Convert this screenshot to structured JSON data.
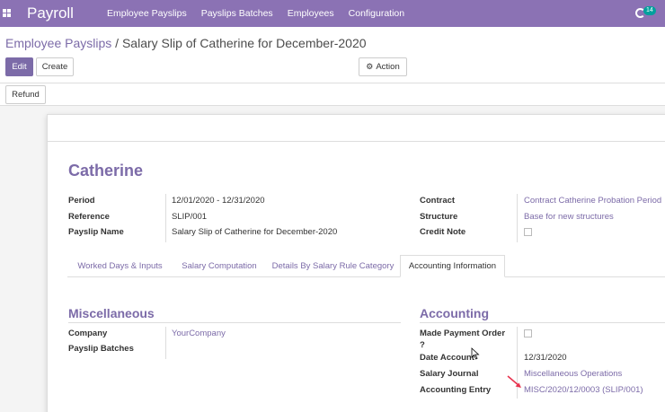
{
  "topbar": {
    "app_name": "Payroll",
    "menu": [
      "Employee Payslips",
      "Payslips Batches",
      "Employees",
      "Configuration"
    ],
    "activity_count": "14"
  },
  "breadcrumb": {
    "parent": "Employee Payslips",
    "separator": "/",
    "current": "Salary Slip of Catherine for December-2020"
  },
  "buttons": {
    "edit": "Edit",
    "create": "Create",
    "action": "Action",
    "refund": "Refund"
  },
  "record": {
    "employee_name": "Catherine",
    "left_fields": [
      {
        "label": "Period",
        "value": "12/01/2020 - 12/31/2020"
      },
      {
        "label": "Reference",
        "value": "SLIP/001"
      },
      {
        "label": "Payslip Name",
        "value": "Salary Slip of Catherine for December-2020"
      }
    ],
    "right_fields": [
      {
        "label": "Contract",
        "value": "Contract Catherine Probation Period"
      },
      {
        "label": "Structure",
        "value": "Base for new structures"
      },
      {
        "label": "Credit Note",
        "value": ""
      }
    ]
  },
  "tabs": [
    "Worked Days & Inputs",
    "Salary Computation",
    "Details By Salary Rule Category",
    "Accounting Information"
  ],
  "active_tab": "Accounting Information",
  "misc": {
    "title": "Miscellaneous",
    "company_label": "Company",
    "company_value": "YourCompany",
    "batches_label": "Payslip Batches",
    "batches_value": ""
  },
  "accounting": {
    "title": "Accounting",
    "made_payment_label_1": "Made Payment Order",
    "made_payment_label_2": "?",
    "date_label": "Date Account",
    "date_value": "12/31/2020",
    "journal_label": "Salary Journal",
    "journal_value": "Miscellaneous Operations",
    "entry_label": "Accounting Entry",
    "entry_value": "MISC/2020/12/0003 (SLIP/001)"
  },
  "colors": {
    "brand": "#8b72b4",
    "link": "#7c6ba8",
    "badge": "#00a09d",
    "annotation_arrow": "#e8334f"
  }
}
